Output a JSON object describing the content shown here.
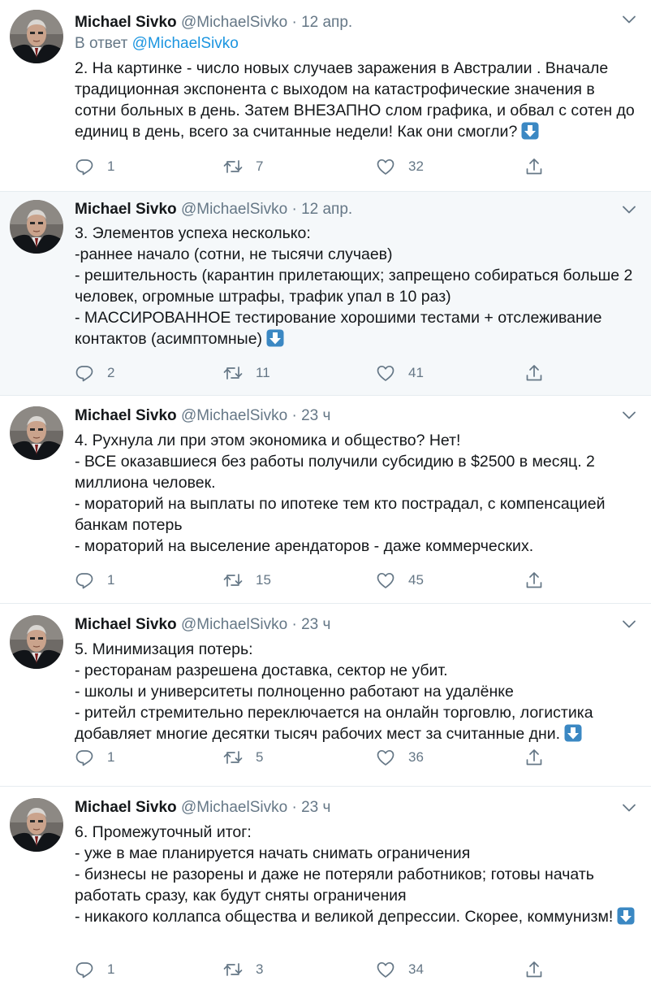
{
  "colors": {
    "accent": "#1b95e0",
    "muted": "#657786",
    "text": "#14171a",
    "highlight_bg": "#f5f8fa",
    "emoji_blue": "#3b88c3"
  },
  "icons": {
    "reply": "reply-icon",
    "retweet": "retweet-icon",
    "like": "heart-icon",
    "share": "share-icon",
    "menu": "chevron-down-icon",
    "emoji": "down-arrow-emoji"
  },
  "tweets": [
    {
      "name": "Michael Sivko",
      "handle": "@MichaelSivko",
      "sep": " · ",
      "time": "12 апр.",
      "reply_to_label": "В ответ ",
      "reply_to_handle": "@MichaelSivko",
      "text": "2. На картинке - число новых случаев заражения в Австралии . Вначале традиционная экспонента с выходом на катастрофические значения в сотни больных в день. Затем ВНЕЗАПНО слом графика, и обвал с сотен до единиц в день, всего за считанные недели! Как они смогли?",
      "replies": "1",
      "retweets": "7",
      "likes": "32"
    },
    {
      "name": "Michael Sivko",
      "handle": "@MichaelSivko",
      "sep": " · ",
      "time": "12 апр.",
      "text": "3. Элементов успеха несколько:\n-раннее начало (сотни, не тысячи случаев)\n- решительность (карантин прилетающих; запрещено собираться больше 2 человек, огромные штрафы, трафик упал в 10 раз)\n- МАССИРОВАННОЕ тестирование хорошими тестами + отслеживание контактов (асимптомные)",
      "replies": "2",
      "retweets": "11",
      "likes": "41"
    },
    {
      "name": "Michael Sivko",
      "handle": "@MichaelSivko",
      "sep": " · ",
      "time": "23 ч",
      "text": "4. Рухнула ли при этом экономика и общество? Нет!\n- ВСЕ оказавшиеся без работы получили субсидию в $2500 в месяц. 2 миллиона человек.\n- мораторий на выплаты по ипотеке тем кто пострадал, с компенсацией банкам потерь\n- мораторий на выселение арендаторов - даже коммерческих.",
      "replies": "1",
      "retweets": "15",
      "likes": "45"
    },
    {
      "name": "Michael Sivko",
      "handle": "@MichaelSivko",
      "sep": " · ",
      "time": "23 ч",
      "text": "5. Минимизация потерь:\n- ресторанам разрешена доставка, сектор не убит.\n- школы и университеты полноценно работают на удалёнке\n- ритейл стремительно переключается на онлайн торговлю, логистика добавляет многие десятки тысяч рабочих мест за считанные дни.",
      "replies": "1",
      "retweets": "5",
      "likes": "36"
    },
    {
      "name": "Michael Sivko",
      "handle": "@MichaelSivko",
      "sep": " · ",
      "time": "23 ч",
      "text": "6. Промежуточный итог:\n- уже в мае планируется начать снимать ограничения\n- бизнесы не разорены и даже не потеряли работников; готовы начать работать сразу, как будут сняты ограничения\n- никакого коллапса общества и великой депрессии. Скорее, коммунизм!",
      "replies": "1",
      "retweets": "3",
      "likes": "34"
    }
  ]
}
